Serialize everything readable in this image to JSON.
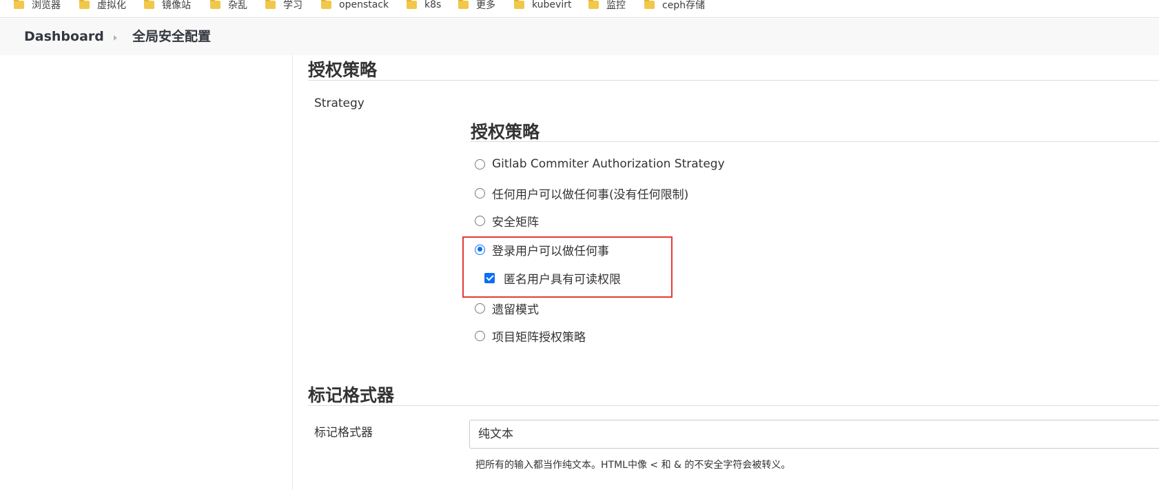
{
  "bookmarks": [
    {
      "label": "浏览器",
      "icon": "folder-icon"
    },
    {
      "label": "虚拟化",
      "icon": "folder-icon"
    },
    {
      "label": "镜像站",
      "icon": "folder-icon"
    },
    {
      "label": "杂乱",
      "icon": "folder-icon"
    },
    {
      "label": "学习",
      "icon": "folder-icon"
    },
    {
      "label": "openstack",
      "icon": "folder-icon"
    },
    {
      "label": "k8s",
      "icon": "folder-icon"
    },
    {
      "label": "更多",
      "icon": "folder-icon"
    },
    {
      "label": "kubevirt",
      "icon": "folder-icon"
    },
    {
      "label": "监控",
      "icon": "folder-icon"
    },
    {
      "label": "ceph存储",
      "icon": "folder-icon"
    }
  ],
  "breadcrumb": {
    "items": [
      "Dashboard",
      "全局安全配置"
    ],
    "separator_icon": "chevron-right-icon"
  },
  "authorization": {
    "section_title": "授权策略",
    "field_label": "Strategy",
    "group_title": "授权策略",
    "options": [
      {
        "label": "Gitlab Commiter Authorization Strategy",
        "selected": false
      },
      {
        "label": "任何用户可以做任何事(没有任何限制)",
        "selected": false
      },
      {
        "label": "安全矩阵",
        "selected": false
      },
      {
        "label": "登录用户可以做任何事",
        "selected": true
      },
      {
        "label": "遗留模式",
        "selected": false
      },
      {
        "label": "项目矩阵授权策略",
        "selected": false
      }
    ],
    "anonymous_read": {
      "label": "匿名用户具有可读权限",
      "checked": true
    },
    "highlight_color": "#e53935"
  },
  "markup": {
    "section_title": "标记格式器",
    "field_label": "标记格式器",
    "selected_value": "纯文本",
    "help_text": "把所有的输入都当作纯文本。HTML中像 < 和 & 的不安全字符会被转义。"
  },
  "colors": {
    "accent": "#0b6ef6",
    "breadcrumb_bg": "#f8f8f8",
    "folder": "#f2c84b"
  }
}
